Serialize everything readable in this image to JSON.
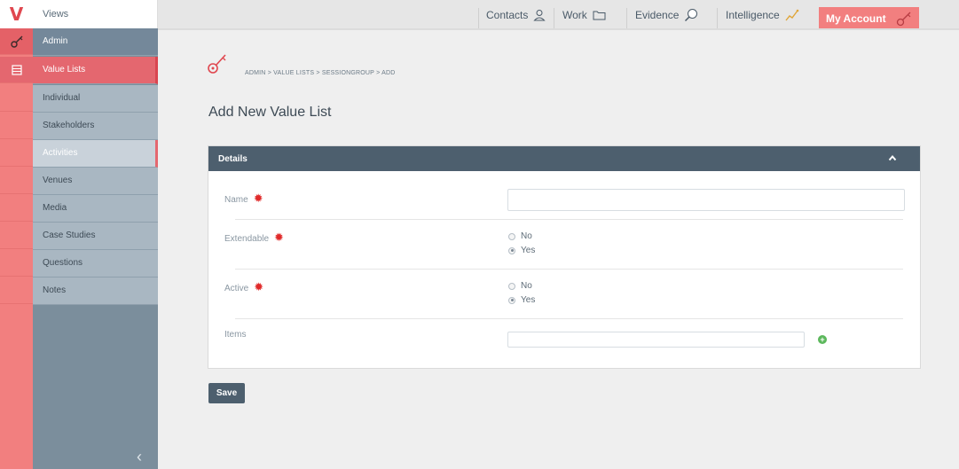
{
  "app": {
    "logo_letter": "V"
  },
  "sidebar": {
    "views_label": "Views",
    "sections": [
      {
        "label": "Admin"
      },
      {
        "label": "Value Lists"
      }
    ],
    "items": [
      {
        "label": "Individual"
      },
      {
        "label": "Stakeholders"
      },
      {
        "label": "Activities"
      },
      {
        "label": "Venues"
      },
      {
        "label": "Media"
      },
      {
        "label": "Case Studies"
      },
      {
        "label": "Questions"
      },
      {
        "label": "Notes"
      }
    ]
  },
  "topnav": {
    "items": [
      {
        "label": "Contacts",
        "icon": "person-icon"
      },
      {
        "label": "Work",
        "icon": "folder-icon"
      },
      {
        "label": "Evidence",
        "icon": "magnifier-icon"
      },
      {
        "label": "Intelligence",
        "icon": "trend-line-icon"
      }
    ],
    "account_label": "My Account",
    "account_icon": "key-icon"
  },
  "breadcrumb": {
    "parts": [
      "ADMIN",
      "VALUE LISTS",
      "SESSIONGROUP",
      "ADD"
    ],
    "separator": ">"
  },
  "page": {
    "title": "Add New Value List"
  },
  "panel": {
    "title": "Details",
    "fields": {
      "name": {
        "label": "Name",
        "value": ""
      },
      "extendable": {
        "label": "Extendable",
        "options": [
          "No",
          "Yes"
        ],
        "selected": "Yes"
      },
      "active": {
        "label": "Active",
        "options": [
          "No",
          "Yes"
        ],
        "selected": "Yes"
      },
      "items": {
        "label": "Items",
        "value": ""
      }
    }
  },
  "actions": {
    "save_label": "Save"
  },
  "colors": {
    "accent": "#f27f7f",
    "sidebar": "#7b8e9c",
    "panel_header": "#4d5f6e"
  }
}
